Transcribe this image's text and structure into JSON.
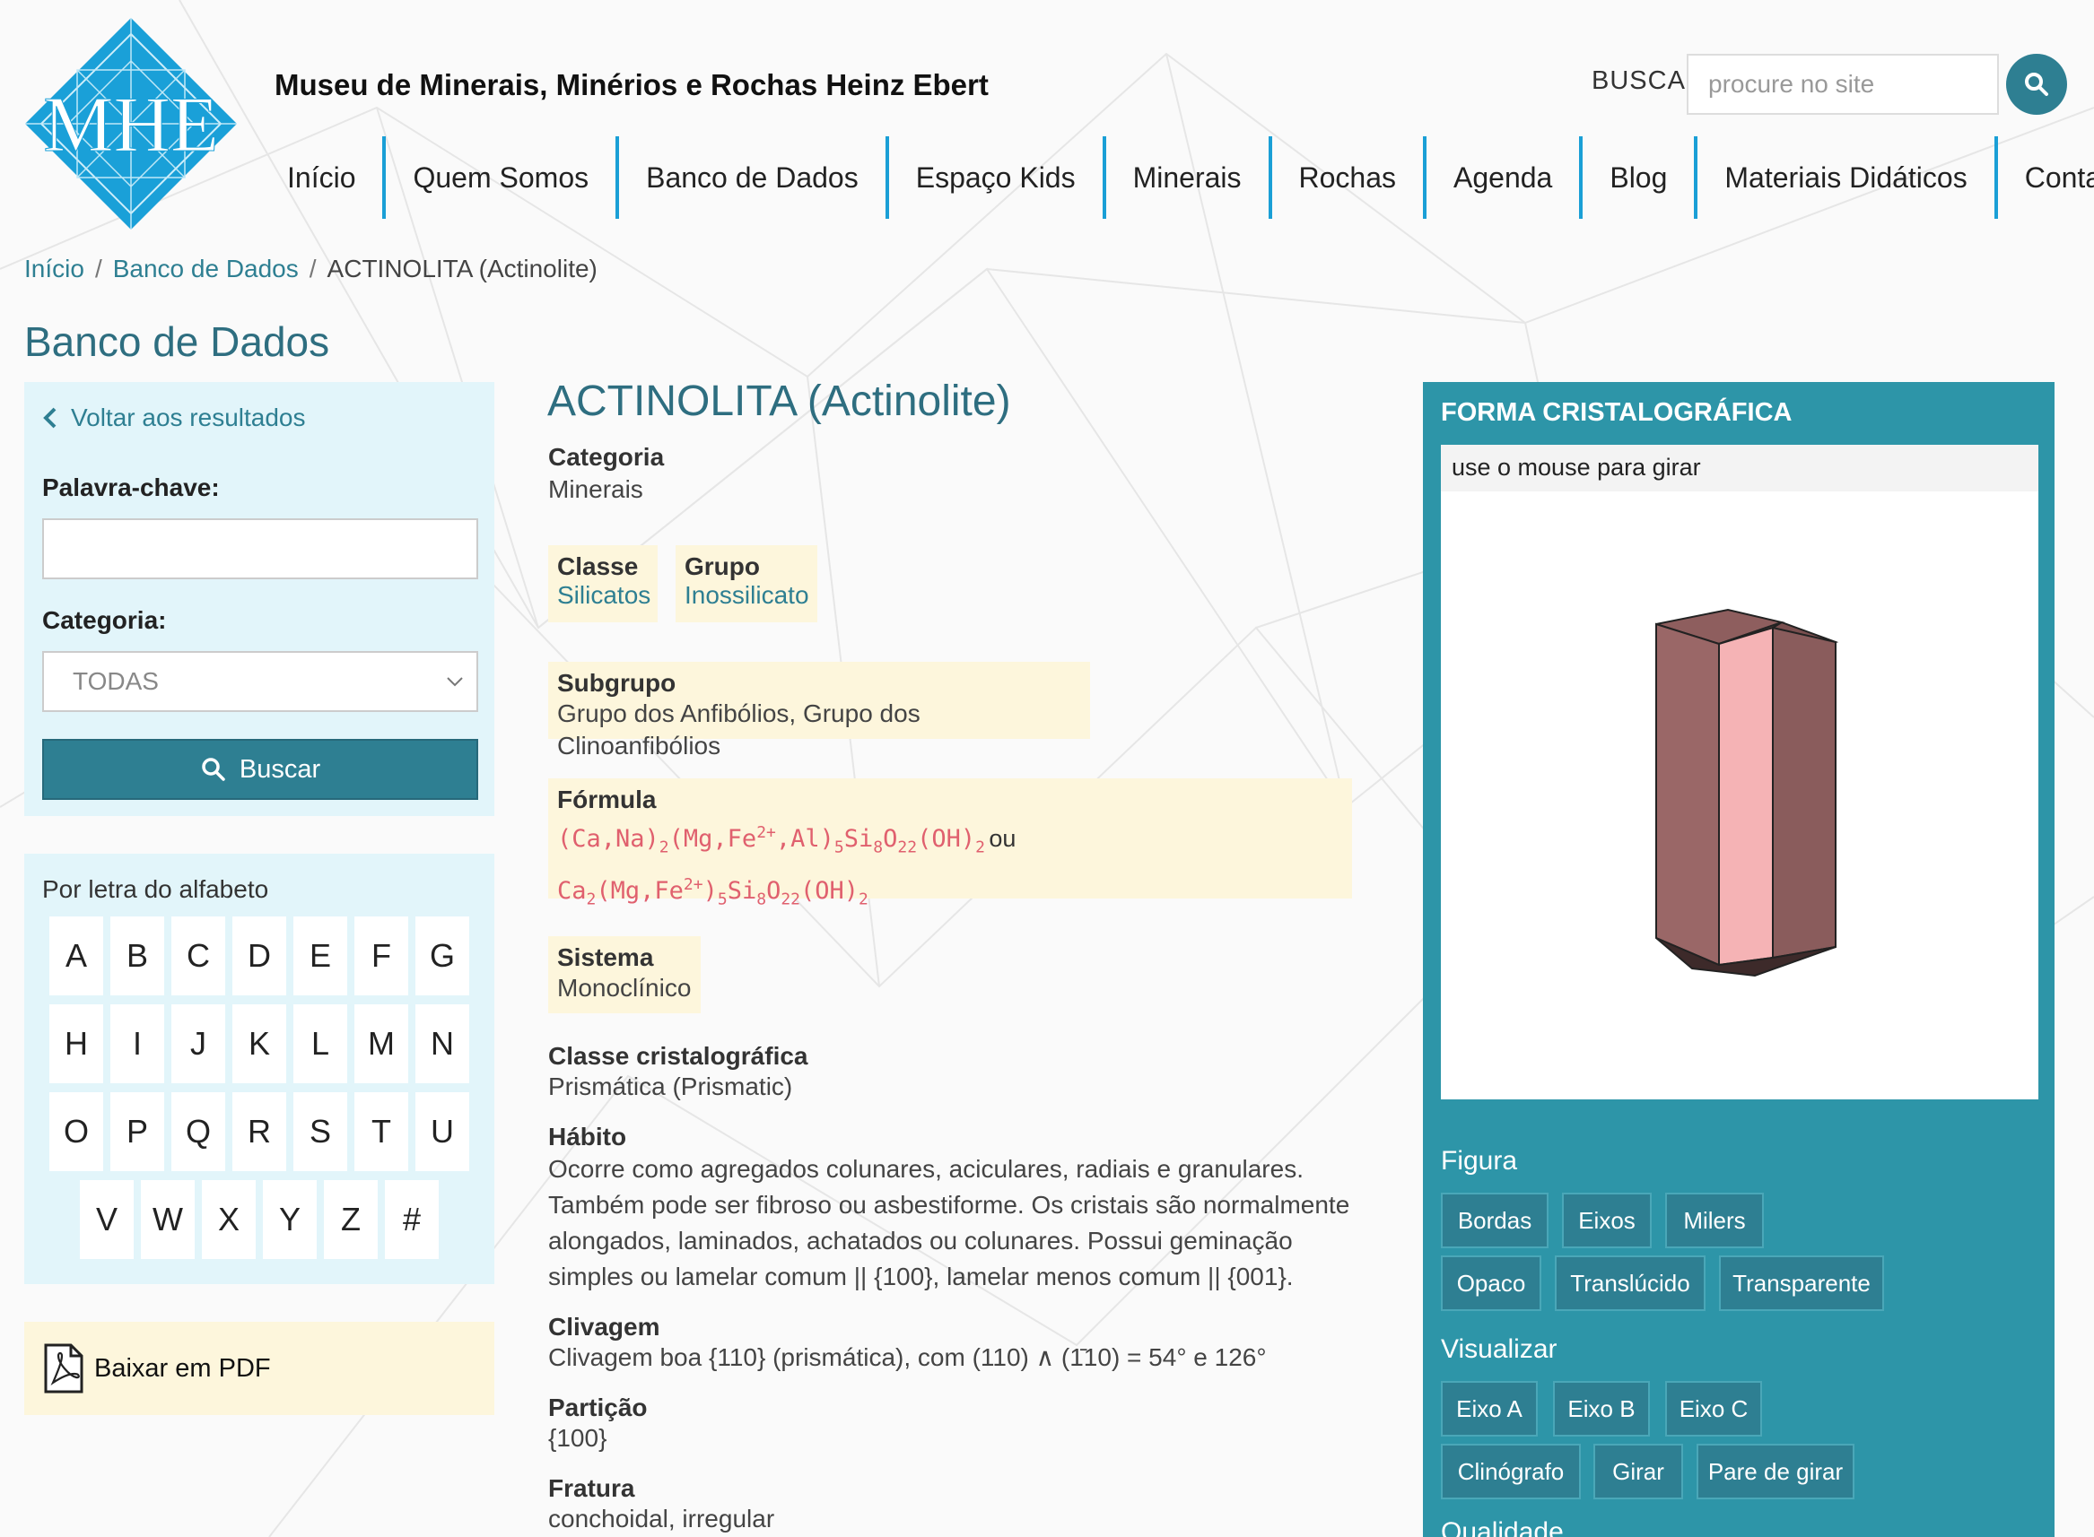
{
  "header": {
    "site_title": "Museu de Minerais, Minérios e Rochas Heinz Ebert",
    "logo_text": "MHE",
    "search_label": "BUSCA",
    "search_placeholder": "procure no site"
  },
  "nav": [
    {
      "label": "Início"
    },
    {
      "label": "Quem Somos"
    },
    {
      "label": "Banco de Dados"
    },
    {
      "label": "Espaço Kids"
    },
    {
      "label": "Minerais"
    },
    {
      "label": "Rochas"
    },
    {
      "label": "Agenda"
    },
    {
      "label": "Blog"
    },
    {
      "label": "Materiais Didáticos"
    },
    {
      "label": "Contato"
    }
  ],
  "breadcrumb": {
    "home": "Início",
    "section": "Banco de Dados",
    "current": "ACTINOLITA (Actinolite)"
  },
  "page_title": "Banco de Dados",
  "sidebar": {
    "back_label": "Voltar aos resultados",
    "keyword_label": "Palavra-chave:",
    "keyword_value": "",
    "category_label": "Categoria:",
    "category_selected": "TODAS",
    "search_button": "Buscar",
    "alphabet_title": "Por letra do alfabeto",
    "alphabet_rows": [
      [
        "A",
        "B",
        "C",
        "D",
        "E",
        "F",
        "G"
      ],
      [
        "H",
        "I",
        "J",
        "K",
        "L",
        "M",
        "N"
      ],
      [
        "O",
        "P",
        "Q",
        "R",
        "S",
        "T",
        "U"
      ],
      [
        "V",
        "W",
        "X",
        "Y",
        "Z",
        "#"
      ]
    ],
    "pdf_label": "Baixar em PDF"
  },
  "mineral": {
    "name": "ACTINOLITA (Actinolite)",
    "categoria_label": "Categoria",
    "categoria": "Minerais",
    "classe_label": "Classe",
    "classe": "Silicatos",
    "grupo_label": "Grupo",
    "grupo": "Inossilicato",
    "subgrupo_label": "Subgrupo",
    "subgrupo": "Grupo dos Anfibólios, Grupo dos Clinoanfibólios",
    "formula_label": "Fórmula",
    "formula_connector": "ou",
    "sistema_label": "Sistema",
    "sistema": "Monoclínico",
    "classe_cristalografica_label": "Classe cristalográfica",
    "classe_cristalografica": "Prismática (Prismatic)",
    "habito_label": "Hábito",
    "habito": "Ocorre como agregados colunares, aciculares, radiais e granulares. Também pode ser fibroso ou asbestiforme. Os cristais são normalmente alongados, laminados, achatados ou colunares. Possui geminação simples ou lamelar comum || {100}, lamelar menos comum || {001}.",
    "clivagem_label": "Clivagem",
    "clivagem": "Clivagem boa {110} (prismática), com (110) ∧ (1̄10) = 54° e 126°",
    "particao_label": "Partição",
    "particao": "{100}",
    "fratura_label": "Fratura",
    "fratura": "conchoidal, irregular"
  },
  "crystal_panel": {
    "title": "FORMA CRISTALOGRÁFICA",
    "hint": "use o mouse para girar",
    "figura_title": "Figura",
    "figura_buttons": [
      "Bordas",
      "Eixos",
      "Milers",
      "Opaco",
      "Translúcido",
      "Transparente"
    ],
    "visualizar_title": "Visualizar",
    "visualizar_buttons": [
      "Eixo A",
      "Eixo B",
      "Eixo C",
      "Clinógrafo",
      "Girar",
      "Pare de girar"
    ],
    "qualidade_title": "Qualidade"
  },
  "colors": {
    "accent": "#2e7f92",
    "nav_divider": "#1a9fd6",
    "panel_bg": "#e2f5fa",
    "highlight_bg": "#fdf6dc",
    "crystal_panel_bg": "#2d95a8",
    "formula_color": "#e0606e"
  },
  "icons": {
    "logo": "mhe-diamond-logo",
    "search": "search-icon",
    "back": "chevron-left-icon",
    "dropdown": "chevron-down-icon",
    "pdf": "pdf-icon"
  }
}
